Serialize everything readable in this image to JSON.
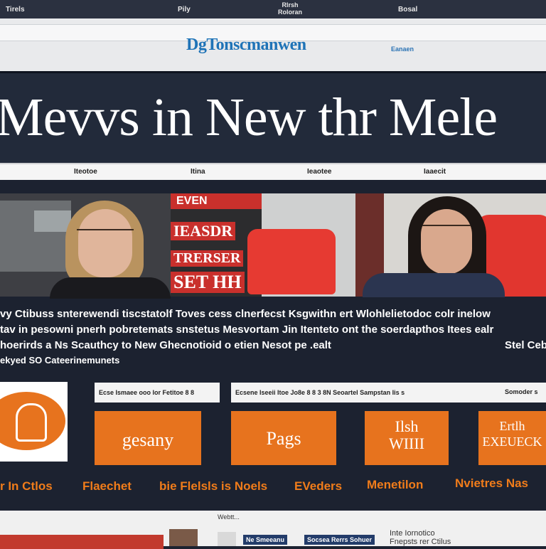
{
  "topbar": {
    "left": "Tirels",
    "mid1": "Pily",
    "mid2": "Rlrsh\nRoloran",
    "right": "Bosal"
  },
  "site": {
    "logo": "DgTonscmanwen",
    "logo_sub": "Eanaen"
  },
  "headline": "Mevvs in New thr Mele",
  "nav": {
    "items": [
      "Iteotoe",
      "Itina",
      "Ieaotee",
      "Iaaecit"
    ]
  },
  "hero": {
    "sign_top": "EVEN",
    "sign_lines": [
      "IEASDR",
      "TRERSER",
      "SET HH"
    ]
  },
  "article": {
    "line1": "vy Ctibuss snterewendi tiscstatolf Toves cess clnerfecst Ksgwithn ert  Wlohlelietodoc colr inelow",
    "line2": "tav in pesowni pnerh pobretemats  snstetus Mesvortam Jin Itenteto ont the soerdapthos Itees ealr",
    "line3": "hoerirds a  Ns Scauthcy to New Ghecnotioid o etien  Nesot pe .ealt",
    "line3_right": "Stel Ceb",
    "line4": "ekyed SO Cateerinemunets"
  },
  "tiles": [
    {
      "head": "Ecse  Ismaee ooo lor Fetitoe  8 8",
      "box": "gesany",
      "caption": "Flaechet"
    },
    {
      "head": "Ecsene  Iseeii  Itoe  Jo8e 8 8 3 8N  Seoartel Sampstan Iis s",
      "box": "Pags",
      "caption": "bie Flelsls is Noels"
    },
    {
      "head": "",
      "box": "Ilsh\nWIIII",
      "caption": "EVeders"
    },
    {
      "head": "Somoder s",
      "box": "Ertlh\nEXEUECK",
      "caption": "Menetilon"
    }
  ],
  "captions": {
    "first": "r In Ctlos",
    "last": "Nvietres Nas"
  },
  "bottom": {
    "label1": "Webtt...",
    "btn1": "Ne Smeeanu",
    "btn2": "Socsea Rerrs Sohuer",
    "right_text1": "Inte Iornotico",
    "right_text2": "Fnepsts rer Ctilus"
  }
}
